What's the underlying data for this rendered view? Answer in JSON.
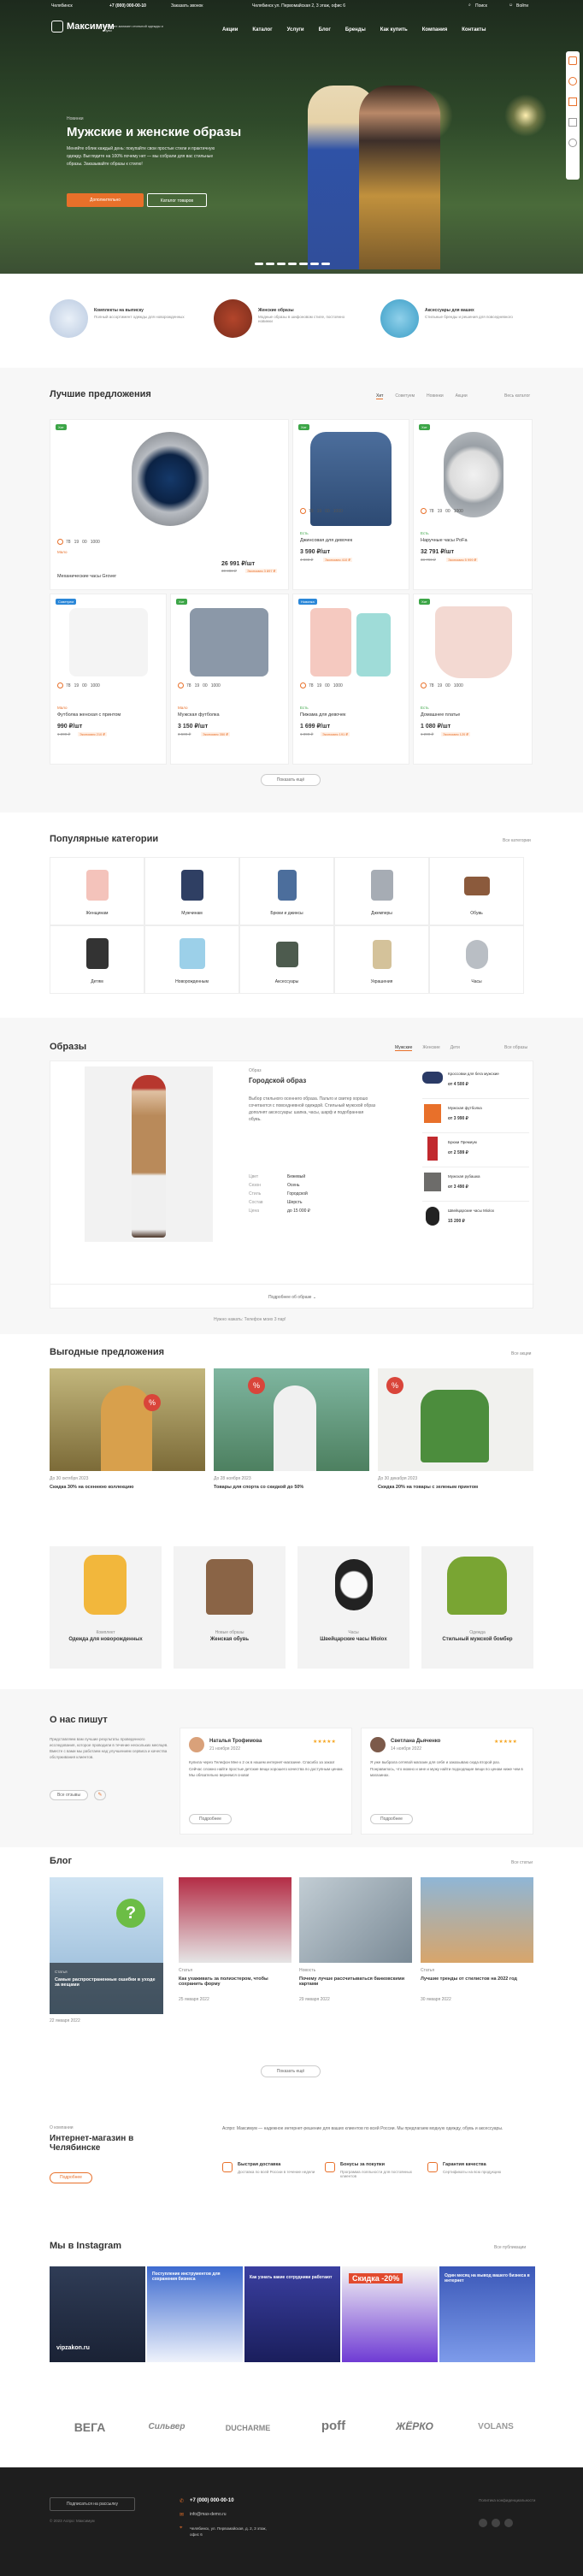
{
  "topbar": {
    "city": "Челябинск",
    "phone": "+7 (000) 000-00-10",
    "callback": "Заказать звонок",
    "address": "Челябинск ул. Первомайская 2, 3 этаж, офис 6",
    "search": "Поиск",
    "login": "Войти"
  },
  "header": {
    "brand": "Максимум",
    "tagline": "Интернет-магазин стильной одежды и обуви",
    "nav": [
      "Акции",
      "Каталог",
      "Услуги",
      "Блог",
      "Бренды",
      "Как купить",
      "Компания",
      "Контакты"
    ]
  },
  "hero": {
    "small": "Новинки",
    "title": "Мужские и женские образы",
    "text": "Меняйте облик каждый день: покупайте свои простые стили и практичную одежду. Выглядите на 100% почему нет — мы собрали для вас стильные образы. Заказывайте образы к стилю!",
    "btn1": "Дополнительно",
    "btn2": "Каталог товаров"
  },
  "features": [
    {
      "title": "Комплекты на выписку",
      "text": "Полный ассортимент одежды для новорожденных"
    },
    {
      "title": "Женские образы",
      "text": "Модные образы в шифоновом стиле, постоянно новинки"
    },
    {
      "title": "Аксессуары для ваших",
      "text": "Стильные бренды и решения для повседневного"
    }
  ],
  "offers": {
    "title": "Лучшие предложения",
    "tabs": [
      "Хит",
      "Советуем",
      "Новинки",
      "Акции"
    ],
    "all": "Весь каталог",
    "more": "Показать ещё",
    "products": [
      {
        "name": "Механические часы Grover",
        "price": "26 991 ₽/шт",
        "old": "30 888 ₽",
        "save": "Экономия 3 897 ₽",
        "timer": [
          "78",
          "19",
          "00",
          "1000"
        ],
        "badge": "Хит",
        "stock": "Мало"
      },
      {
        "name": "Джинсовая для девочек",
        "price": "3 590 ₽/шт",
        "old": "4 000 ₽",
        "save": "Экономия 410 ₽",
        "timer": [
          "78",
          "19",
          "00",
          "1000"
        ],
        "badge": "Хит",
        "stock": "Есть"
      },
      {
        "name": "Наручные часы PoFa",
        "price": "32 791 ₽/шт",
        "old": "38 790 ₽",
        "save": "Экономия 5 999 ₽",
        "timer": [
          "78",
          "19",
          "00",
          "1000"
        ],
        "badge": "Хит",
        "stock": "Есть"
      },
      {
        "name": "Футболка женская с принтом",
        "price": "990 ₽/шт",
        "old": "1 200 ₽",
        "save": "Экономия 210 ₽",
        "timer": [
          "78",
          "19",
          "00",
          "1000"
        ],
        "badge": "Советуем",
        "stock": "Мало"
      },
      {
        "name": "Мужская футболка",
        "price": "3 150 ₽/шт",
        "old": "3 500 ₽",
        "save": "Экономия 350 ₽",
        "timer": [
          "78",
          "19",
          "00",
          "1000"
        ],
        "badge": "Хит",
        "stock": "Мало"
      },
      {
        "name": "Пижама для девочек",
        "price": "1 699 ₽/шт",
        "old": "1 890 ₽",
        "save": "Экономия 191 ₽",
        "timer": [
          "78",
          "19",
          "00",
          "1000"
        ],
        "badge": "Новинка",
        "stock": "Есть"
      },
      {
        "name": "Домашнее платье",
        "price": "1 080 ₽/шт",
        "old": "1 200 ₽",
        "save": "Экономия 120 ₽",
        "timer": [
          "78",
          "19",
          "00",
          "1000"
        ],
        "badge": "Хит",
        "stock": "Есть"
      }
    ]
  },
  "categories": {
    "title": "Популярные категории",
    "all": "Все категории",
    "items": [
      "Женщинам",
      "Мужчинам",
      "Брюки и джинсы",
      "Джемперы",
      "Обувь",
      "Детям",
      "Новорожденным",
      "Аксессуары",
      "Украшения",
      "Часы"
    ]
  },
  "looks": {
    "title": "Образы",
    "tabs": [
      "Мужские",
      "Женские",
      "Дети"
    ],
    "all": "Все образы",
    "look_name": "Городской образ",
    "look_small": "Образ",
    "desc": "Выбор стильного осеннего образа. Пальто и свитер хорошо сочетаются с повседневной одеждой. Стильный мужской образ дополнят аксессуары: шапка, часы, шарф и подобранная обувь.",
    "props": [
      [
        "Цвет",
        "Бежевый"
      ],
      [
        "Сезон",
        "Осень"
      ],
      [
        "Стиль",
        "Городской"
      ],
      [
        "Состав",
        "Шерсть"
      ],
      [
        "Цена",
        "до 15 000 ₽"
      ]
    ],
    "items": [
      {
        "name": "Кроссовки для бега мужские",
        "price": "от 4 500 ₽"
      },
      {
        "name": "Мужская футболка",
        "price": "от 3 990 ₽"
      },
      {
        "name": "Брюки Премиум",
        "price": "от 2 599 ₽"
      },
      {
        "name": "Мужская рубашка",
        "price": "от 3 490 ₽"
      },
      {
        "name": "Швейцарские часы Miolox",
        "price": "15 200 ₽"
      }
    ],
    "more": "Подробнее об образе",
    "dots": "Нужно нажать: Телефон моих 3 пар!"
  },
  "deals": {
    "title": "Выгодные предложения",
    "all": "Все акции",
    "items": [
      {
        "small": "До 30 октября 2023",
        "title": "Скидка 30% на осеннюю коллекцию"
      },
      {
        "small": "До 28 ноября 2023",
        "title": "Товары для спорта со скидкой до 50%"
      },
      {
        "small": "До 30 декабря 2023",
        "title": "Скидка 20% на товары с зеленым принтом"
      }
    ]
  },
  "promo_cards": [
    {
      "small": "Комплект",
      "title": "Одежда для новорожденных"
    },
    {
      "small": "Новые образы",
      "title": "Женская обувь"
    },
    {
      "small": "Часы",
      "title": "Швейцарские часы Miolox"
    },
    {
      "small": "Одежда",
      "title": "Стильный мужской бомбер"
    }
  ],
  "reviews": {
    "title": "О нас пишут",
    "intro": "Представляем вам лучшие результаты проведенного исследования, которое проводили в течение нескольких месяцев. Вместе с вами мы работаем над улучшением сервиса и качества обслуживания клиентов.",
    "all_btn": "Все отзывы",
    "items": [
      {
        "name": "Наталья Трофимова",
        "date": "21 ноября 2022",
        "text": "Купила через Телефон Мне к 2 ок в нашем интернет-магазине. Спасибо за заказ! Сейчас сложно найти простые детские вещи хорошего качества по доступным ценам. Мы обязательно вернемся снова!",
        "btn": "Подробнее"
      },
      {
        "name": "Светлана Дьяченко",
        "date": "14 ноября 2022",
        "text": "Я уже выбрала сетевой магазин для себя и заказываю сюда второй раз. Понравилось, что можно и мне и мужу найти подходящие вещи по ценам ниже чем в магазинах.",
        "btn": "Подробнее"
      }
    ]
  },
  "blog": {
    "title": "Блог",
    "all": "Все статьи",
    "more": "Показать ещё",
    "items": [
      {
        "small": "Статья",
        "title": "Самые распространенные ошибки в уходе за вещами",
        "date": "22 января 2022"
      },
      {
        "small": "Статья",
        "title": "Как ухаживать за полиэстером, чтобы сохранить форму",
        "date": "25 января 2022"
      },
      {
        "small": "Новость",
        "title": "Почему лучше рассчитываться банковскими картами",
        "date": "29 января 2022"
      },
      {
        "small": "Статья",
        "title": "Лучшие тренды от стилистов на 2022 год",
        "date": "30 января 2022"
      }
    ]
  },
  "about": {
    "small": "О компании",
    "title": "Интернет-магазин в Челябинске",
    "btn": "Подробнее",
    "text": "Аспро: Максимум — надежное интернет-решение для ваших клиентов по всей России. Мы предлагаем модную одежду, обувь и аксессуары.",
    "feats": [
      {
        "title": "Быстрая доставка",
        "text": "Доставка по всей России в течение недели"
      },
      {
        "title": "Бонусы за покупки",
        "text": "Программа лояльности для постоянных клиентов"
      },
      {
        "title": "Гарантия качества",
        "text": "Сертификаты на всю продукцию"
      }
    ]
  },
  "instagram": {
    "title": "Мы в Instagram",
    "link": "Все публикации",
    "posts": [
      "vipzakon.ru",
      "Поступление инструментов для сохранения бизнеса",
      "Как узнать какие сотрудники работают",
      "Скидка -20%",
      "Один месяц на вывод вашего бизнеса в интернет"
    ]
  },
  "brands": [
    "ВЕГА",
    "Сильвер",
    "DUCHARME",
    "poff",
    "ЖЁРКО",
    "VOLANS"
  ],
  "footer": {
    "subscribe": "Подписаться на рассылку",
    "phone": "+7 (000) 000-00-10",
    "email": "info@max-demo.ru",
    "address": "Челябинск, ул. Первомайская, д. 2, 3 этаж, офис 6",
    "copy": "© 2023 Аспро: Максимум",
    "policy": "Политика конфиденциальности"
  },
  "colors": {
    "accent": "#e8702a",
    "dark": "#1e1e1e"
  }
}
